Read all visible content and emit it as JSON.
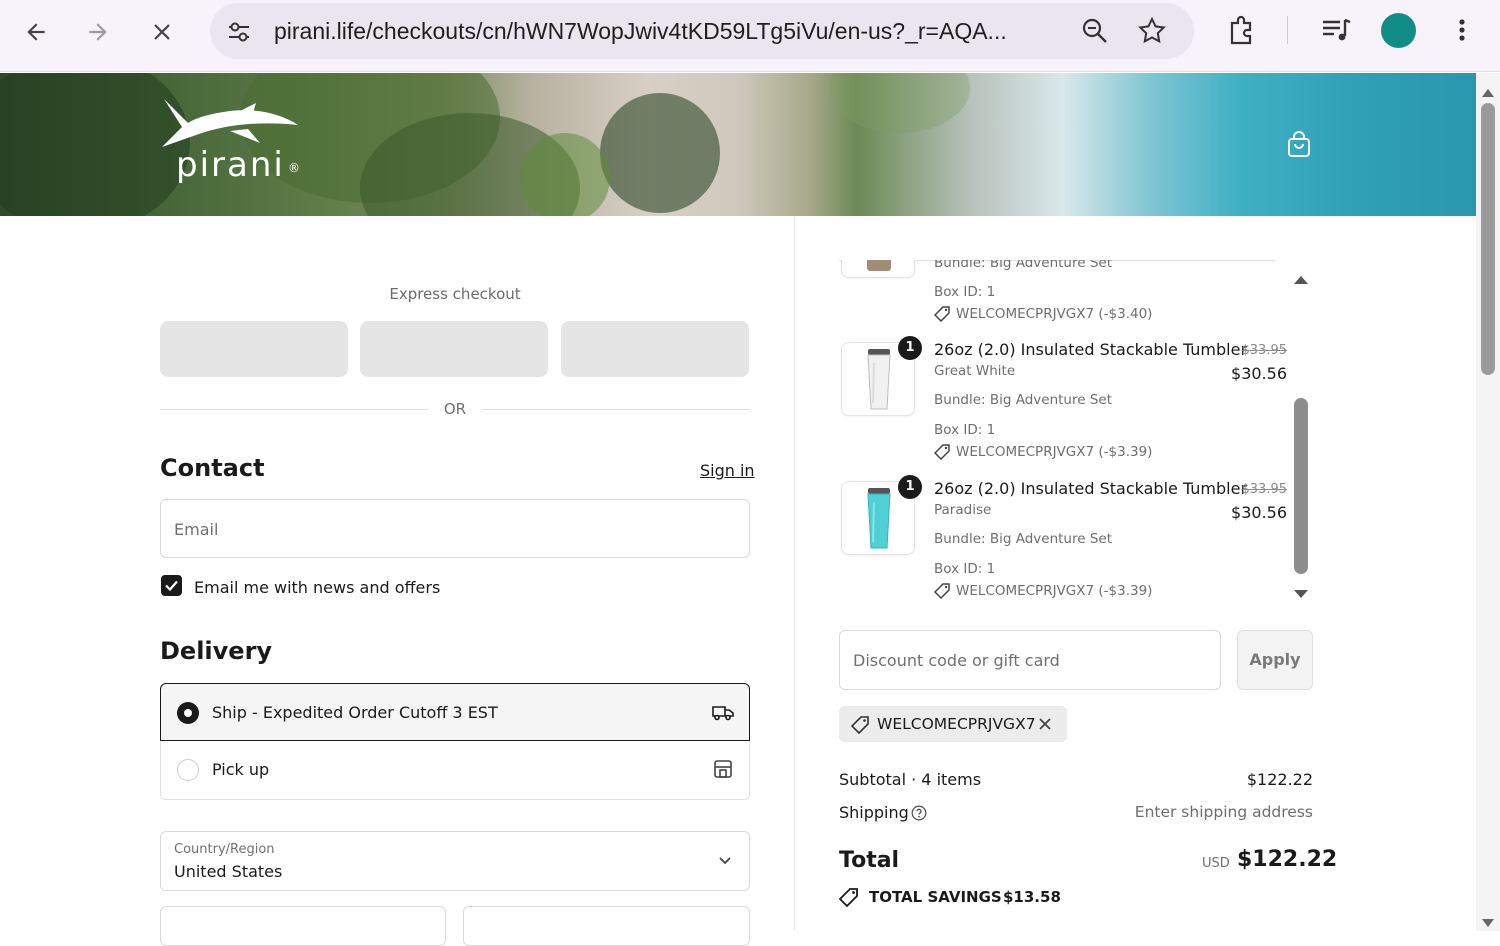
{
  "browser": {
    "url": "pirani.life/checkouts/cn/hWN7WopJwiv4tKD59LTg5iVu/en-us?_r=AQA..."
  },
  "brand": {
    "name": "pirani",
    "registered": "®"
  },
  "express_checkout": {
    "title": "Express checkout",
    "or_label": "OR"
  },
  "contact": {
    "heading": "Contact",
    "sign_in": "Sign in",
    "email_placeholder": "Email",
    "newsletter_label": "Email me with news and offers",
    "newsletter_checked": true
  },
  "delivery": {
    "heading": "Delivery",
    "options": [
      {
        "label": "Ship - Expedited Order Cutoff 3 EST",
        "selected": true,
        "icon": "truck-icon"
      },
      {
        "label": "Pick up",
        "selected": false,
        "icon": "store-icon"
      }
    ],
    "country_label": "Country/Region",
    "country_value": "United States"
  },
  "summary": {
    "items": [
      {
        "name": "",
        "variant": "",
        "bundle": "Bundle: Big Adventure Set",
        "box_id": "Box ID: 1",
        "discount": "WELCOMECPRJVGX7 (-$3.40)",
        "quantity": "",
        "compare_price": "",
        "price": ""
      },
      {
        "name": "26oz (2.0) Insulated Stackable Tumbler",
        "variant": "Great White",
        "bundle": "Bundle: Big Adventure Set",
        "box_id": "Box ID: 1",
        "discount": "WELCOMECPRJVGX7 (-$3.39)",
        "quantity": "1",
        "compare_price": "$33.95",
        "price": "$30.56"
      },
      {
        "name": "26oz (2.0) Insulated Stackable Tumbler",
        "variant": "Paradise",
        "bundle": "Bundle: Big Adventure Set",
        "box_id": "Box ID: 1",
        "discount": "WELCOMECPRJVGX7 (-$3.39)",
        "quantity": "1",
        "compare_price": "$33.95",
        "price": "$30.56"
      }
    ],
    "discount_placeholder": "Discount code or gift card",
    "apply_label": "Apply",
    "applied_code": "WELCOMECPRJVGX7",
    "subtotal_label": "Subtotal · 4 items",
    "subtotal_value": "$122.22",
    "shipping_label": "Shipping",
    "shipping_value": "Enter shipping address",
    "total_label": "Total",
    "currency": "USD",
    "total_value": "$122.22",
    "savings_label": "TOTAL SAVINGS",
    "savings_value": "$13.58"
  },
  "colors": {
    "accent_dark": "#1a1a1a",
    "avatar": "#118c87",
    "tumbler_paradise": "#4fd0d6",
    "tumbler_white": "#f2f2f2"
  }
}
